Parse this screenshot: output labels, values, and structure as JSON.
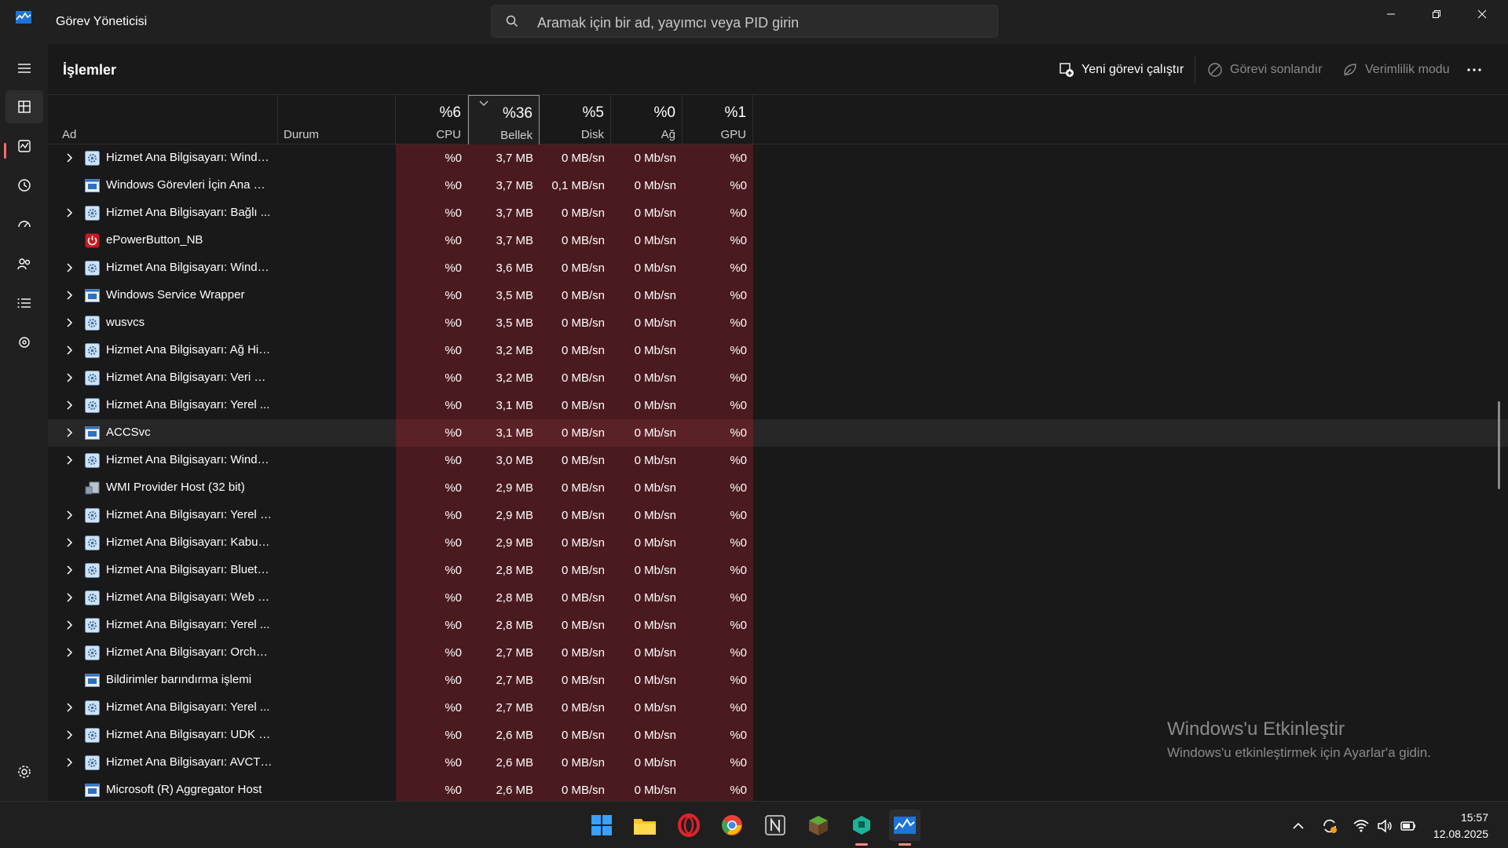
{
  "app": {
    "title": "Görev Yöneticisi",
    "search_placeholder": "Aramak için bir ad, yayımcı veya PID girin"
  },
  "page": {
    "title": "İşlemler",
    "toolbar": {
      "new_task": "Yeni görevi çalıştır",
      "end_task": "Görevi sonlandır",
      "efficiency": "Verimlilik modu"
    }
  },
  "columns": {
    "name": "Ad",
    "status": "Durum",
    "cpu": {
      "pct": "%6",
      "label": "CPU"
    },
    "memory": {
      "pct": "%36",
      "label": "Bellek"
    },
    "disk": {
      "pct": "%5",
      "label": "Disk"
    },
    "network": {
      "pct": "%0",
      "label": "Ağ"
    },
    "gpu": {
      "pct": "%1",
      "label": "GPU"
    }
  },
  "rows": [
    {
      "name": "Hizmet Ana Bilgisayarı: Windo...",
      "icon": "service-gear",
      "expandable": true,
      "cpu": "%0",
      "mem": "3,7 MB",
      "disk": "0 MB/sn",
      "net": "0 Mb/sn",
      "gpu": "%0"
    },
    {
      "name": "Windows Görevleri İçin Ana Bi...",
      "icon": "window-app",
      "expandable": false,
      "cpu": "%0",
      "mem": "3,7 MB",
      "disk": "0,1 MB/sn",
      "net": "0 Mb/sn",
      "gpu": "%0"
    },
    {
      "name": "Hizmet Ana Bilgisayarı: Bağlı ...",
      "icon": "service-gear",
      "expandable": true,
      "cpu": "%0",
      "mem": "3,7 MB",
      "disk": "0 MB/sn",
      "net": "0 Mb/sn",
      "gpu": "%0"
    },
    {
      "name": "ePowerButton_NB",
      "icon": "power-red",
      "expandable": false,
      "cpu": "%0",
      "mem": "3,7 MB",
      "disk": "0 MB/sn",
      "net": "0 Mb/sn",
      "gpu": "%0"
    },
    {
      "name": "Hizmet Ana Bilgisayarı: Windo...",
      "icon": "service-gear",
      "expandable": true,
      "cpu": "%0",
      "mem": "3,6 MB",
      "disk": "0 MB/sn",
      "net": "0 Mb/sn",
      "gpu": "%0"
    },
    {
      "name": "Windows Service Wrapper",
      "icon": "window-app",
      "expandable": true,
      "cpu": "%0",
      "mem": "3,5 MB",
      "disk": "0 MB/sn",
      "net": "0 Mb/sn",
      "gpu": "%0"
    },
    {
      "name": "wusvcs",
      "icon": "service-gear",
      "expandable": true,
      "cpu": "%0",
      "mem": "3,5 MB",
      "disk": "0 MB/sn",
      "net": "0 Mb/sn",
      "gpu": "%0"
    },
    {
      "name": "Hizmet Ana Bilgisayarı: Ağ Hiz...",
      "icon": "service-gear",
      "expandable": true,
      "cpu": "%0",
      "mem": "3,2 MB",
      "disk": "0 MB/sn",
      "net": "0 Mb/sn",
      "gpu": "%0"
    },
    {
      "name": "Hizmet Ana Bilgisayarı: Veri Pa...",
      "icon": "service-gear",
      "expandable": true,
      "cpu": "%0",
      "mem": "3,2 MB",
      "disk": "0 MB/sn",
      "net": "0 Mb/sn",
      "gpu": "%0"
    },
    {
      "name": "Hizmet Ana Bilgisayarı: Yerel ...",
      "icon": "service-gear",
      "expandable": true,
      "cpu": "%0",
      "mem": "3,1 MB",
      "disk": "0 MB/sn",
      "net": "0 Mb/sn",
      "gpu": "%0"
    },
    {
      "name": "ACCSvc",
      "icon": "window-app",
      "expandable": true,
      "selected": true,
      "cpu": "%0",
      "mem": "3,1 MB",
      "disk": "0 MB/sn",
      "net": "0 Mb/sn",
      "gpu": "%0"
    },
    {
      "name": "Hizmet Ana Bilgisayarı: Windo...",
      "icon": "service-gear",
      "expandable": true,
      "cpu": "%0",
      "mem": "3,0 MB",
      "disk": "0 MB/sn",
      "net": "0 Mb/sn",
      "gpu": "%0"
    },
    {
      "name": "WMI Provider Host (32 bit)",
      "icon": "wmi-host",
      "expandable": false,
      "cpu": "%0",
      "mem": "2,9 MB",
      "disk": "0 MB/sn",
      "net": "0 Mb/sn",
      "gpu": "%0"
    },
    {
      "name": "Hizmet Ana Bilgisayarı: Yerel S...",
      "icon": "service-gear",
      "expandable": true,
      "cpu": "%0",
      "mem": "2,9 MB",
      "disk": "0 MB/sn",
      "net": "0 Mb/sn",
      "gpu": "%0"
    },
    {
      "name": "Hizmet Ana Bilgisayarı: Kabuk ...",
      "icon": "service-gear",
      "expandable": true,
      "cpu": "%0",
      "mem": "2,9 MB",
      "disk": "0 MB/sn",
      "net": "0 Mb/sn",
      "gpu": "%0"
    },
    {
      "name": "Hizmet Ana Bilgisayarı: Blueto...",
      "icon": "service-gear",
      "expandable": true,
      "cpu": "%0",
      "mem": "2,8 MB",
      "disk": "0 MB/sn",
      "net": "0 Mb/sn",
      "gpu": "%0"
    },
    {
      "name": "Hizmet Ana Bilgisayarı: Web H...",
      "icon": "service-gear",
      "expandable": true,
      "cpu": "%0",
      "mem": "2,8 MB",
      "disk": "0 MB/sn",
      "net": "0 Mb/sn",
      "gpu": "%0"
    },
    {
      "name": "Hizmet Ana Bilgisayarı: Yerel ...",
      "icon": "service-gear",
      "expandable": true,
      "cpu": "%0",
      "mem": "2,8 MB",
      "disk": "0 MB/sn",
      "net": "0 Mb/sn",
      "gpu": "%0"
    },
    {
      "name": "Hizmet Ana Bilgisayarı: Orches...",
      "icon": "service-gear",
      "expandable": true,
      "cpu": "%0",
      "mem": "2,7 MB",
      "disk": "0 MB/sn",
      "net": "0 Mb/sn",
      "gpu": "%0"
    },
    {
      "name": "Bildirimler barındırma işlemi",
      "icon": "window-app",
      "expandable": false,
      "cpu": "%0",
      "mem": "2,7 MB",
      "disk": "0 MB/sn",
      "net": "0 Mb/sn",
      "gpu": "%0"
    },
    {
      "name": "Hizmet Ana Bilgisayarı: Yerel ...",
      "icon": "service-gear",
      "expandable": true,
      "cpu": "%0",
      "mem": "2,7 MB",
      "disk": "0 MB/sn",
      "net": "0 Mb/sn",
      "gpu": "%0"
    },
    {
      "name": "Hizmet Ana Bilgisayarı: UDK K...",
      "icon": "service-gear",
      "expandable": true,
      "cpu": "%0",
      "mem": "2,6 MB",
      "disk": "0 MB/sn",
      "net": "0 Mb/sn",
      "gpu": "%0"
    },
    {
      "name": "Hizmet Ana Bilgisayarı: AVCTP...",
      "icon": "service-gear",
      "expandable": true,
      "cpu": "%0",
      "mem": "2,6 MB",
      "disk": "0 MB/sn",
      "net": "0 Mb/sn",
      "gpu": "%0"
    },
    {
      "name": "Microsoft (R) Aggregator Host",
      "icon": "window-app",
      "expandable": false,
      "cpu": "%0",
      "mem": "2,6 MB",
      "disk": "0 MB/sn",
      "net": "0 Mb/sn",
      "gpu": "%0"
    }
  ],
  "watermark": {
    "title": "Windows'u Etkinleştir",
    "subtitle": "Windows'u etkinleştirmek için Ayarlar'a gidin."
  },
  "taskbar": {
    "apps": [
      "start-icon",
      "file-explorer-icon",
      "opera-icon",
      "chrome-icon",
      "notion-icon",
      "minecraft-icon",
      "app-teal-icon",
      "task-manager-icon"
    ],
    "clock_time": "15:57",
    "clock_date": "12.08.2025"
  },
  "colors": {
    "heat_cell": "#4a1a1e",
    "accent": "#ff6b6b",
    "background": "#191919"
  }
}
